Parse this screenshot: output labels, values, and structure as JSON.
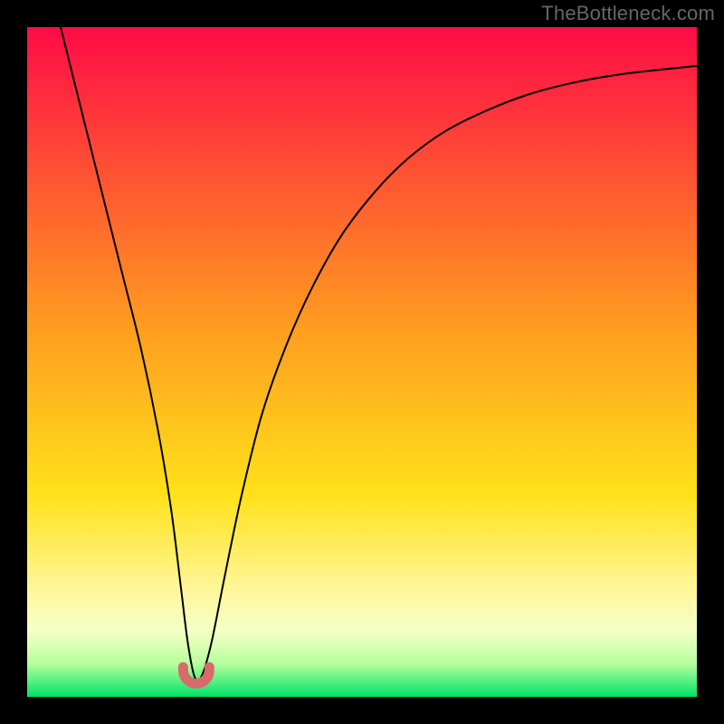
{
  "watermark": "TheBottleneck.com",
  "chart_data": {
    "type": "line",
    "title": "",
    "xlabel": "",
    "ylabel": "",
    "xlim": [
      0,
      100
    ],
    "ylim": [
      0,
      100
    ],
    "grid": false,
    "legend": false,
    "background_gradient": {
      "stops": [
        {
          "offset": 0.0,
          "color": "#ff0b46"
        },
        {
          "offset": 0.45,
          "color": "#ff9d1f"
        },
        {
          "offset": 0.7,
          "color": "#ffe21a"
        },
        {
          "offset": 0.84,
          "color": "#fff69a"
        },
        {
          "offset": 0.9,
          "color": "#f5ffc6"
        },
        {
          "offset": 0.95,
          "color": "#b8ff9e"
        },
        {
          "offset": 1.0,
          "color": "#00e268"
        }
      ]
    },
    "series": [
      {
        "name": "bottleneck-curve",
        "color": "#000000",
        "x": [
          5,
          8,
          11,
          14,
          17,
          19.5,
          21.5,
          23,
          24,
          25,
          26,
          27.5,
          29.5,
          32,
          35,
          38.5,
          42.5,
          47,
          52,
          57,
          62.5,
          68.5,
          75,
          82,
          89,
          96,
          100
        ],
        "y": [
          100,
          88,
          76,
          64,
          52,
          40,
          28,
          16,
          8,
          3,
          3,
          8,
          18,
          30,
          42,
          52,
          61,
          69,
          75.5,
          80.5,
          84.5,
          87.5,
          90,
          91.8,
          93,
          93.8,
          94.2
        ]
      },
      {
        "name": "min-bottleneck-marker",
        "type": "marker",
        "color": "#d86a6a",
        "shape": "U",
        "x_range": [
          23.3,
          27.2
        ],
        "y": 2.0
      }
    ]
  }
}
